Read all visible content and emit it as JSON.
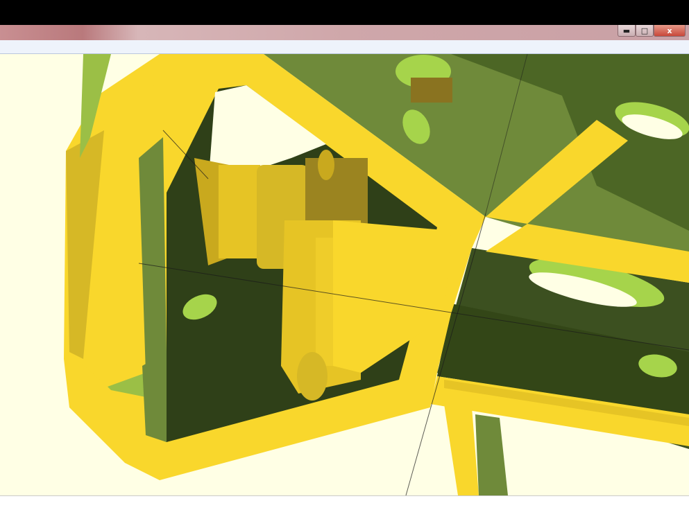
{
  "window": {
    "title": "",
    "minimize_symbol": "",
    "maximize_symbol": "",
    "close_symbol": "x"
  },
  "toolbar": {},
  "viewport": {
    "description_icon": "3d-model-icon",
    "colors": {
      "background": "#ffffe5",
      "front_face": "#f9d72c",
      "back_face": "#6f8a3a",
      "dark_interior": "#2f4018",
      "highlight_green": "#a6d44b",
      "axis": "#1a1a1a"
    }
  },
  "status": {
    "text": ""
  }
}
